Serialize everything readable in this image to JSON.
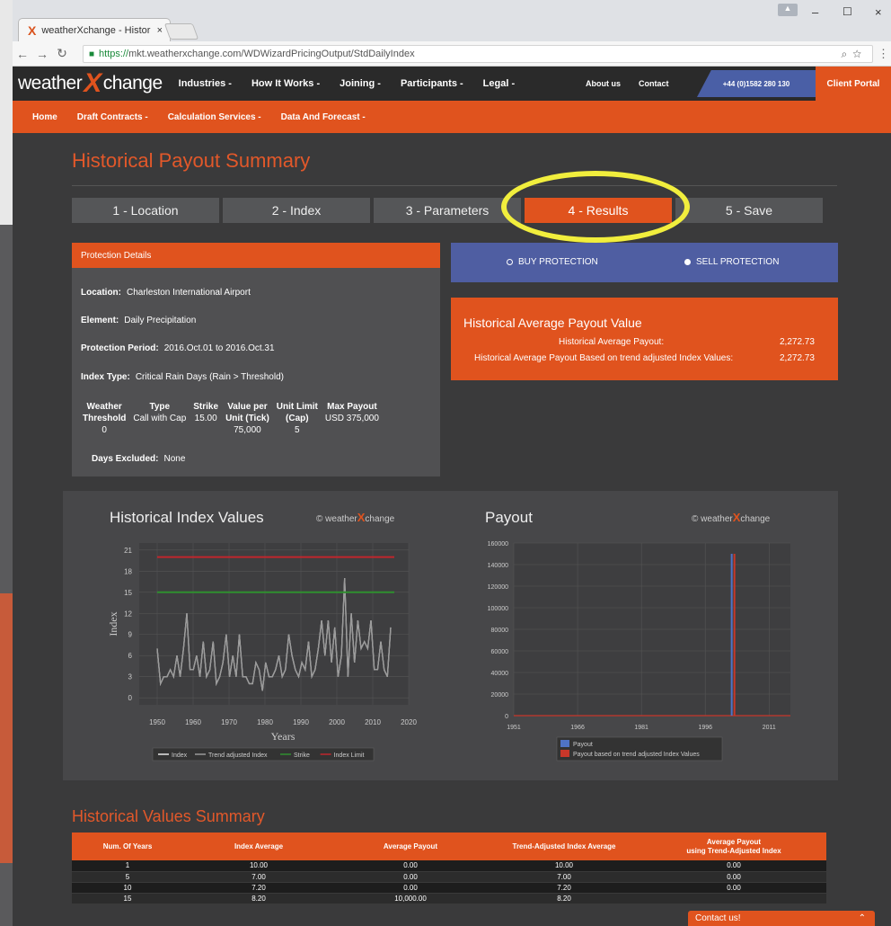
{
  "browser": {
    "tab_title": "weatherXchange - Histor",
    "tab_close": "×",
    "url_prefix": "https://",
    "url": "mkt.weatherxchange.com/WDWizardPricingOutput/StdDailyIndex",
    "win_min": "–",
    "win_max": "☐",
    "win_close": "×"
  },
  "header": {
    "logo_left": "weather",
    "logo_x": "X",
    "logo_right": "change",
    "nav": [
      "Industries -",
      "How It Works -",
      "Joining -",
      "Participants -",
      "Legal -"
    ],
    "about": "About us",
    "contact": "Contact",
    "phone": "+44 (0)1582 280 130",
    "portal": "Client Portal"
  },
  "subnav": [
    "Home",
    "Draft Contracts -",
    "Calculation Services -",
    "Data And Forecast -"
  ],
  "page_title": "Historical Payout Summary",
  "steps": [
    "1 - Location",
    "2 - Index",
    "3 - Parameters",
    "4 - Results",
    "5 - Save"
  ],
  "protection": {
    "heading": "Protection Details",
    "location_label": "Location:",
    "location": "Charleston International Airport",
    "element_label": "Element:",
    "element": "Daily Precipitation",
    "period_label": "Protection Period:",
    "period": "2016.Oct.01 to 2016.Oct.31",
    "index_label": "Index Type:",
    "index": "Critical Rain Days (Rain > Threshold)",
    "table": [
      {
        "h": [
          "Weather",
          "Threshold"
        ],
        "v": [
          "0"
        ]
      },
      {
        "h": [
          "Type"
        ],
        "v": [
          "Call with Cap"
        ]
      },
      {
        "h": [
          "Strike"
        ],
        "v": [
          "15.00"
        ]
      },
      {
        "h": [
          "Value per",
          "Unit (Tick)"
        ],
        "v": [
          "75,000"
        ]
      },
      {
        "h": [
          "Unit Limit",
          "(Cap)"
        ],
        "v": [
          "5"
        ]
      },
      {
        "h": [
          "Max Payout"
        ],
        "v": [
          "USD 375,000"
        ]
      }
    ],
    "days_label": "Days Excluded:",
    "days": "None"
  },
  "buysell": {
    "buy": "BUY PROTECTION",
    "sell": "SELL PROTECTION"
  },
  "hapv": {
    "title": "Historical Average Payout Value",
    "row1_label": "Historical Average Payout:",
    "row1_value": "2,272.73",
    "row2_label": "Historical Average Payout Based on trend adjusted Index Values:",
    "row2_value": "2,272.73"
  },
  "copyright": {
    "symbol": "©",
    "w1": "weather",
    "x": "X",
    "w2": "change"
  },
  "chart_data": [
    {
      "type": "line",
      "title": "Historical Index Values",
      "xlabel": "Years",
      "ylabel": "Index",
      "xlim": [
        1945,
        2020
      ],
      "ylim": [
        -1,
        22
      ],
      "xticks": [
        1950,
        1960,
        1970,
        1980,
        1990,
        2000,
        2010,
        2020
      ],
      "yticks": [
        0,
        3,
        6,
        9,
        12,
        15,
        18,
        21
      ],
      "x": [
        1950,
        1951,
        1952,
        1953,
        1954,
        1955,
        1956,
        1957,
        1958,
        1959,
        1960,
        1961,
        1962,
        1963,
        1964,
        1965,
        1966,
        1967,
        1968,
        1969,
        1970,
        1971,
        1972,
        1973,
        1974,
        1975,
        1976,
        1977,
        1978,
        1979,
        1980,
        1981,
        1982,
        1983,
        1984,
        1985,
        1986,
        1987,
        1988,
        1989,
        1990,
        1991,
        1992,
        1993,
        1994,
        1995,
        1996,
        1997,
        1998,
        1999,
        2000,
        2001,
        2002,
        2003,
        2004,
        2005,
        2006,
        2007,
        2008,
        2009,
        2010,
        2011,
        2012,
        2013,
        2014,
        2015
      ],
      "series": [
        {
          "name": "Index",
          "values": [
            7,
            2,
            3,
            3,
            4,
            3,
            6,
            3,
            7,
            12,
            4,
            4,
            6,
            3,
            8,
            3,
            4,
            8,
            2,
            3,
            5,
            9,
            3,
            6,
            3,
            9,
            3,
            3,
            2,
            2,
            5,
            4,
            1,
            5,
            3,
            3,
            4,
            6,
            3,
            4,
            9,
            6,
            4,
            3,
            5,
            4,
            8,
            3,
            4,
            7,
            11,
            6,
            11,
            5,
            10,
            3,
            6,
            17,
            3,
            12,
            5,
            11,
            7,
            8,
            7,
            11,
            4,
            4,
            8,
            4,
            3,
            10
          ]
        },
        {
          "name": "Trend adjusted Index",
          "values": [
            7,
            2,
            3,
            3,
            4,
            3,
            6,
            3,
            7,
            12,
            4,
            4,
            6,
            3,
            8,
            3,
            4,
            8,
            2,
            3,
            5,
            9,
            3,
            6,
            3,
            9,
            3,
            3,
            2,
            2,
            5,
            4,
            1,
            5,
            3,
            3,
            4,
            6,
            3,
            4,
            9,
            6,
            4,
            3,
            5,
            4,
            8,
            3,
            4,
            7,
            11,
            6,
            11,
            5,
            10,
            3,
            6,
            17,
            3,
            12,
            5,
            11,
            7,
            8,
            7,
            11,
            4,
            4,
            8,
            4,
            3,
            10
          ]
        },
        {
          "name": "Strike",
          "constant": 15
        },
        {
          "name": "Index Limit",
          "constant": 20
        }
      ],
      "colors": {
        "Index": "#e6e6e6",
        "Trend adjusted Index": "#9a9a9a",
        "Strike": "#2f8f2f",
        "Index Limit": "#c0262c"
      }
    },
    {
      "type": "bar",
      "title": "Payout",
      "xlim": [
        1951,
        2016
      ],
      "ylim": [
        0,
        160000
      ],
      "xticks": [
        1951,
        1966,
        1981,
        1996,
        2011
      ],
      "yticks": [
        0,
        20000,
        40000,
        60000,
        80000,
        100000,
        120000,
        140000,
        160000
      ],
      "x": [
        2002
      ],
      "series": [
        {
          "name": "Payout",
          "values": [
            150000
          ]
        },
        {
          "name": "Payout based on trend adjusted Index Values",
          "values": [
            150000
          ]
        }
      ],
      "colors": {
        "Payout": "#4f73c6",
        "Payout based on trend adjusted Index Values": "#c8372a"
      }
    }
  ],
  "summary": {
    "title": "Historical Values Summary",
    "columns": [
      [
        "Num. Of Years"
      ],
      [
        "Index Average"
      ],
      [
        "Average Payout"
      ],
      [
        "Trend-Adjusted Index Average"
      ],
      [
        "Average Payout",
        "using Trend-Adjusted Index"
      ]
    ],
    "rows": [
      [
        "1",
        "10.00",
        "0.00",
        "10.00",
        "0.00"
      ],
      [
        "5",
        "7.00",
        "0.00",
        "7.00",
        "0.00"
      ],
      [
        "10",
        "7.20",
        "0.00",
        "7.20",
        "0.00"
      ],
      [
        "15",
        "8.20",
        "10,000.00",
        "8.20",
        ""
      ]
    ]
  },
  "contact_widget": {
    "label": "Contact us!",
    "chevron": "⌃"
  }
}
